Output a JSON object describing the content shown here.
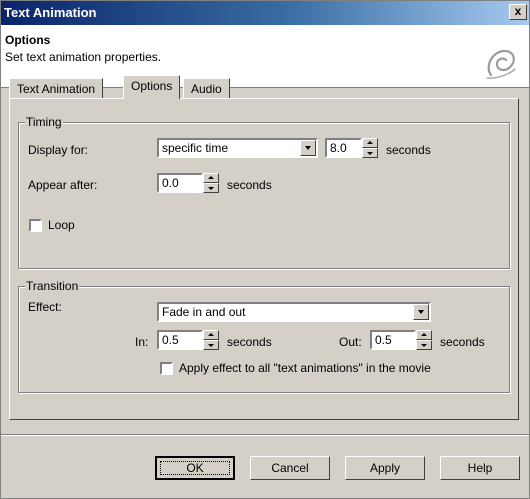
{
  "window": {
    "title": "Text Animation",
    "close_label": "x"
  },
  "header": {
    "title": "Options",
    "subtitle": "Set text animation properties."
  },
  "tabs": [
    {
      "label": "Text Animation",
      "active": false
    },
    {
      "label": "Options",
      "active": true
    },
    {
      "label": "Audio",
      "active": false
    }
  ],
  "timing": {
    "legend": "Timing",
    "display_for_label": "Display for:",
    "display_for_value": "specific time",
    "duration_value": "8.0",
    "duration_unit": "seconds",
    "appear_after_label": "Appear after:",
    "appear_after_value": "0.0",
    "appear_after_unit": "seconds",
    "loop_label": "Loop",
    "loop_checked": false
  },
  "transition": {
    "legend": "Transition",
    "effect_label": "Effect:",
    "effect_value": "Fade in and out",
    "in_label": "In:",
    "in_value": "0.5",
    "in_unit": "seconds",
    "out_label": "Out:",
    "out_value": "0.5",
    "out_unit": "seconds",
    "apply_all_label": "Apply effect to all \"text animations\" in the movie",
    "apply_all_checked": false
  },
  "buttons": {
    "ok": "OK",
    "cancel": "Cancel",
    "apply": "Apply",
    "help": "Help"
  },
  "colors": {
    "title_bar": "#0a246a",
    "dialog_face": "#d4d0c8"
  },
  "icons": {
    "logo": "swirl-logo-icon"
  }
}
